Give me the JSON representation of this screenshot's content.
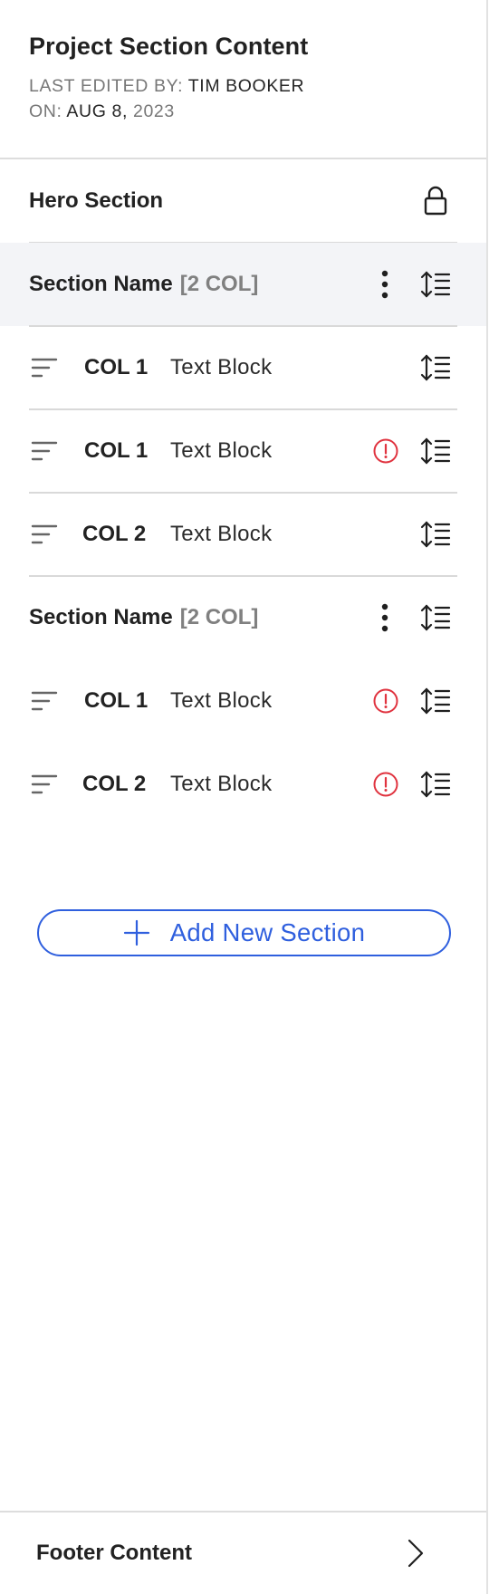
{
  "panel": {
    "title": "Project Section Content",
    "last_edited_label": "LAST EDITED BY:",
    "last_edited_by": "TIM BOOKER",
    "on_label": "ON:",
    "date_main": "AUG 8,",
    "date_year": "2023"
  },
  "hero": {
    "label": "Hero Section",
    "icon": "lock-icon"
  },
  "sections": [
    {
      "name": "Section Name",
      "badge": "[2 COL]",
      "rows": [
        {
          "col": "COL 1",
          "label": "Text Block",
          "alert": false
        },
        {
          "col": "COL 1",
          "label": "Text Block",
          "alert": true
        },
        {
          "col": "COL 2",
          "label": "Text Block",
          "alert": false
        }
      ]
    },
    {
      "name": "Section Name",
      "badge": "[2 COL]",
      "rows": [
        {
          "col": "COL 1",
          "label": "Text Block",
          "alert": true
        },
        {
          "col": "COL 2",
          "label": "Text Block",
          "alert": true
        }
      ]
    }
  ],
  "add_button": {
    "label": "Add New Section",
    "icon": "plus-icon"
  },
  "footer": {
    "label": "Footer Content",
    "icon": "chevron-right-icon"
  },
  "colors": {
    "accent": "#2f5fde",
    "alert": "#e0333f",
    "highlight": "#f3f4f7"
  }
}
